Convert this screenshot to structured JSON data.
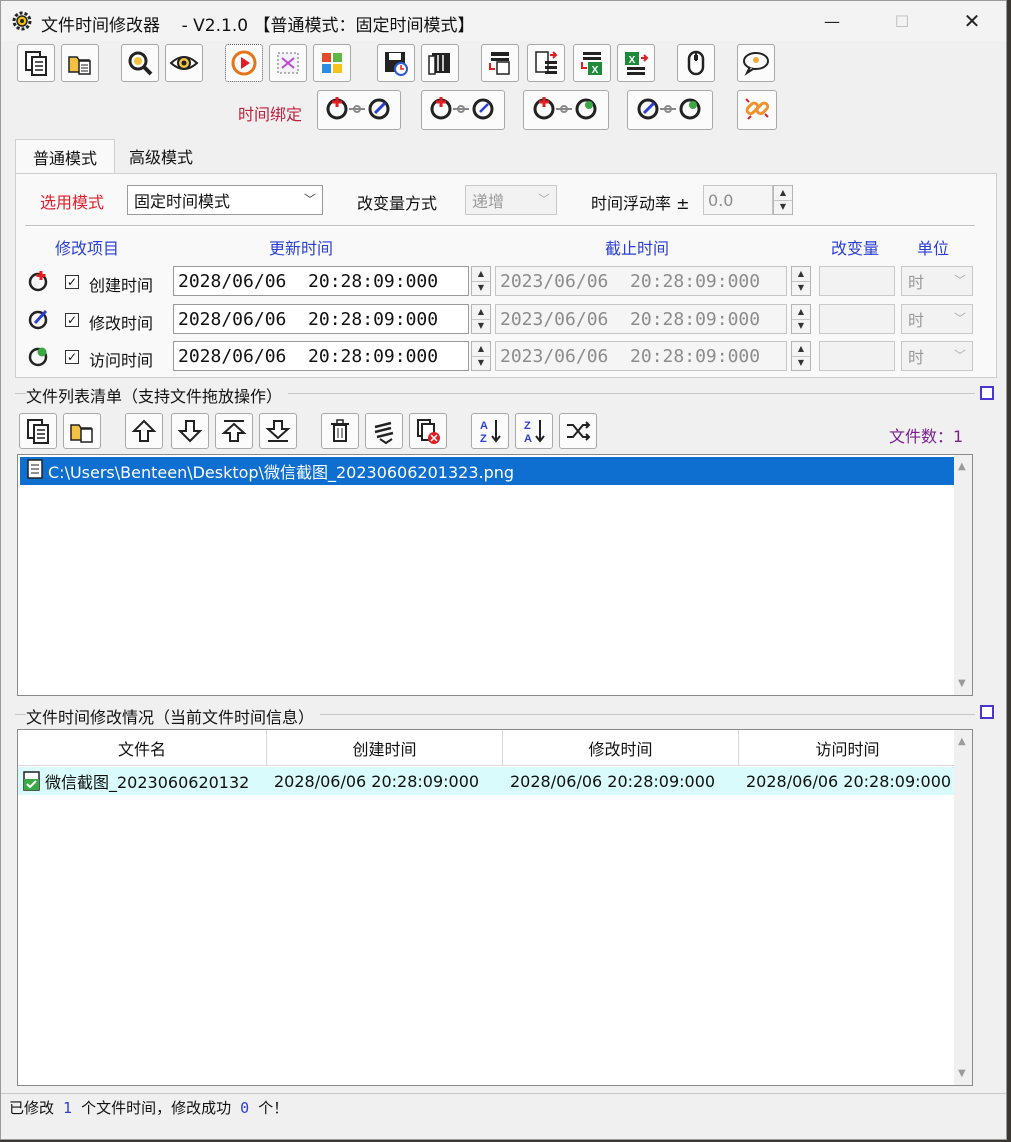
{
  "window": {
    "title": "文件时间修改器    - V2.1.0 【普通模式：固定时间模式】",
    "minimize_glyph": "—",
    "maximize_glyph": "☐",
    "close_glyph": "✕"
  },
  "toolbar_icons": [
    "copy-files-icon",
    "add-folder-icon",
    "zoom-search-icon",
    "preview-eye-icon",
    "run-play-icon",
    "stop-icon",
    "windows-tiles-icon",
    "save-disk-icon",
    "archive-icon",
    "list-import-icon",
    "list-export-icon",
    "excel-import-icon",
    "excel-export-icon",
    "mouse-icon",
    "chat-bubble-icon"
  ],
  "binding": {
    "label": "时间绑定",
    "buttons": [
      "bind-create-modify-icon",
      "bind-create-access-icon",
      "bind-create-access-alt-icon",
      "bind-modify-access-icon",
      "unbind-icon"
    ]
  },
  "tabs": {
    "normal": "普通模式",
    "advanced": "高级模式"
  },
  "settings": {
    "mode_label": "选用模式",
    "mode_value": "固定时间模式",
    "change_label": "改变量方式",
    "change_value": "递增",
    "float_label": "时间浮动率 ±",
    "float_value": "0.0"
  },
  "table_headers": {
    "item": "修改项目",
    "update": "更新时间",
    "deadline": "截止时间",
    "delta": "改变量",
    "unit": "单位"
  },
  "time_rows": [
    {
      "label": "创建时间",
      "checked": "✓",
      "update": "2028/06/06  20:28:09:000",
      "deadline": "2023/06/06  20:28:09:000",
      "unit": "时",
      "icon": "create-time-icon"
    },
    {
      "label": "修改时间",
      "checked": "✓",
      "update": "2028/06/06  20:28:09:000",
      "deadline": "2023/06/06  20:28:09:000",
      "unit": "时",
      "icon": "modify-time-icon"
    },
    {
      "label": "访问时间",
      "checked": "✓",
      "update": "2028/06/06  20:28:09:000",
      "deadline": "2023/06/06  20:28:09:000",
      "unit": "时",
      "icon": "access-time-icon"
    }
  ],
  "file_list": {
    "title": "文件列表清单（支持文件拖放操作）",
    "count_label": "文件数：",
    "count_value": "1",
    "items": [
      "C:\\Users\\Benteen\\Desktop\\微信截图_20230606201323.png"
    ],
    "tool_icons": [
      "copy-files-icon",
      "add-folder-icon",
      "move-up-icon",
      "move-down-icon",
      "move-top-icon",
      "move-bottom-icon",
      "delete-icon",
      "clear-icon",
      "remove-invalid-icon",
      "sort-az-icon",
      "sort-za-icon",
      "shuffle-icon"
    ]
  },
  "status_grid": {
    "title": "文件时间修改情况（当前文件时间信息）",
    "headers": [
      "文件名",
      "创建时间",
      "修改时间",
      "访问时间"
    ],
    "rows": [
      [
        "微信截图_2023060620132",
        "2028/06/06 20:28:09:000",
        "2028/06/06 20:28:09:000",
        "2028/06/06 20:28:09:000"
      ]
    ]
  },
  "statusbar": {
    "part1": "已修改 ",
    "modified": "1",
    "part2": " 个文件时间，修改成功 ",
    "success": "0",
    "part3": " 个！"
  },
  "colors": {
    "accent_red": "#e0202a",
    "label_blue": "#2a3fd6",
    "selection_blue": "#0e6fd0",
    "row_highlight": "#d9fbfb",
    "count_purple": "#7b1e8e"
  }
}
